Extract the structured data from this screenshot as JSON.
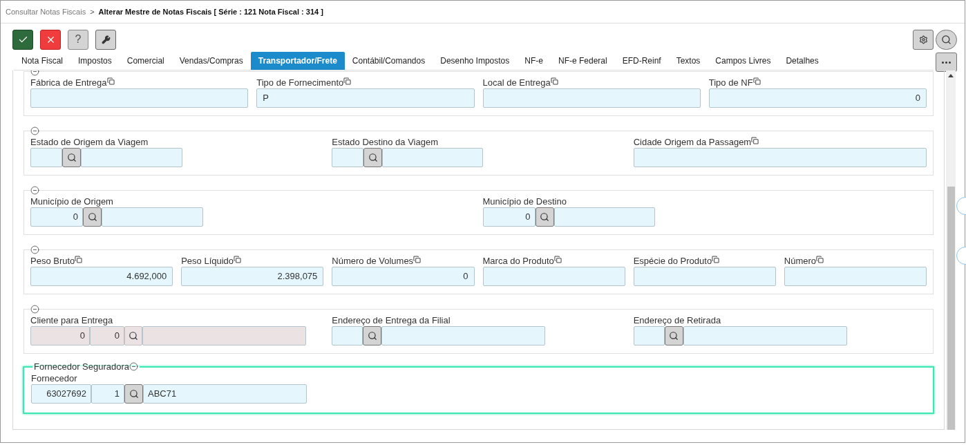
{
  "breadcrumb": {
    "items": [
      "Consultar Notas Fiscais",
      "Alterar Mestre de Notas Fiscais [ Série : 121 Nota Fiscal : 314 ]"
    ],
    "separator": ">"
  },
  "toolbar": [
    {
      "kind": "confirm"
    },
    {
      "kind": "cancel"
    },
    {
      "kind": "help",
      "label": "?"
    },
    {
      "kind": "tools"
    }
  ],
  "tabs": [
    {
      "label": "Nota Fiscal",
      "selected": false
    },
    {
      "label": "Impostos",
      "selected": false
    },
    {
      "label": "Comercial",
      "selected": false
    },
    {
      "label": "Vendas/Compras",
      "selected": false
    },
    {
      "label": "Transportador/Frete",
      "selected": true
    },
    {
      "label": "Contábil/Comandos",
      "selected": false
    },
    {
      "label": "Desenho Impostos",
      "selected": false
    },
    {
      "label": "NF-e",
      "selected": false
    },
    {
      "label": "NF-e Federal",
      "selected": false
    },
    {
      "label": "EFD-Reinf",
      "selected": false
    },
    {
      "label": "Textos",
      "selected": false
    },
    {
      "label": "Campos Livres",
      "selected": false
    },
    {
      "label": "Detalhes",
      "selected": false
    }
  ],
  "sections": [
    {
      "expanded": true,
      "focused": false,
      "fields": [
        {
          "kind": "text",
          "label": "Fábrica de Entrega",
          "copy": true
        },
        {
          "kind": "text",
          "label": "Tipo de Fornecimento",
          "copy": true,
          "value": "P"
        },
        {
          "kind": "text",
          "label": "Local de Entrega",
          "copy": true
        },
        {
          "kind": "number",
          "label": "Tipo de NF",
          "copy": true,
          "value": "0"
        }
      ]
    },
    {
      "expanded": true,
      "focused": false,
      "fields": [
        {
          "kind": "lookup",
          "label": "Estado de Origem da Viagem",
          "copy": false,
          "disabled": false
        },
        {
          "kind": "lookup",
          "label": "Estado Destino da Viagem",
          "copy": false,
          "disabled": false
        },
        {
          "kind": "text",
          "label": "Cidade Origem da Passagem",
          "copy": true
        }
      ]
    },
    {
      "expanded": true,
      "focused": false,
      "fields": [
        {
          "kind": "lookup",
          "label": "Município de Origem",
          "copy": false,
          "disabled": false,
          "codes": [
            "0"
          ]
        },
        {
          "kind": "lookup",
          "label": "Município de Destino",
          "copy": false,
          "disabled": false,
          "codes": [
            "0"
          ]
        }
      ]
    },
    {
      "expanded": true,
      "focused": false,
      "fields": [
        {
          "kind": "number",
          "label": "Peso Bruto",
          "copy": true,
          "value": "4.692,000"
        },
        {
          "kind": "number",
          "label": "Peso Líquido",
          "copy": true,
          "value": "2.398,075"
        },
        {
          "kind": "number",
          "label": "Número de Volumes",
          "copy": true,
          "value": "0"
        },
        {
          "kind": "text",
          "label": "Marca do Produto",
          "copy": true
        },
        {
          "kind": "text",
          "label": "Espécie do Produto",
          "copy": true
        },
        {
          "kind": "text",
          "label": "Número",
          "copy": true
        }
      ]
    },
    {
      "expanded": true,
      "focused": false,
      "fields": [
        {
          "kind": "lookup",
          "label": "Cliente para Entrega",
          "copy": false,
          "disabled": true,
          "codes": [
            "0",
            "0"
          ]
        },
        {
          "kind": "lookup",
          "label": "Endereço de Entrega da Filial",
          "copy": false,
          "disabled": false
        },
        {
          "kind": "lookup",
          "label": "Endereço de Retirada",
          "copy": false,
          "disabled": false
        }
      ]
    },
    {
      "title": "Fornecedor Seguradora",
      "expanded": true,
      "focused": true,
      "fields": [
        {
          "kind": "lookup",
          "label": "Fornecedor",
          "copy": false,
          "disabled": false,
          "codes": [
            "63027692",
            "1"
          ],
          "description": "ABC71"
        }
      ]
    }
  ]
}
